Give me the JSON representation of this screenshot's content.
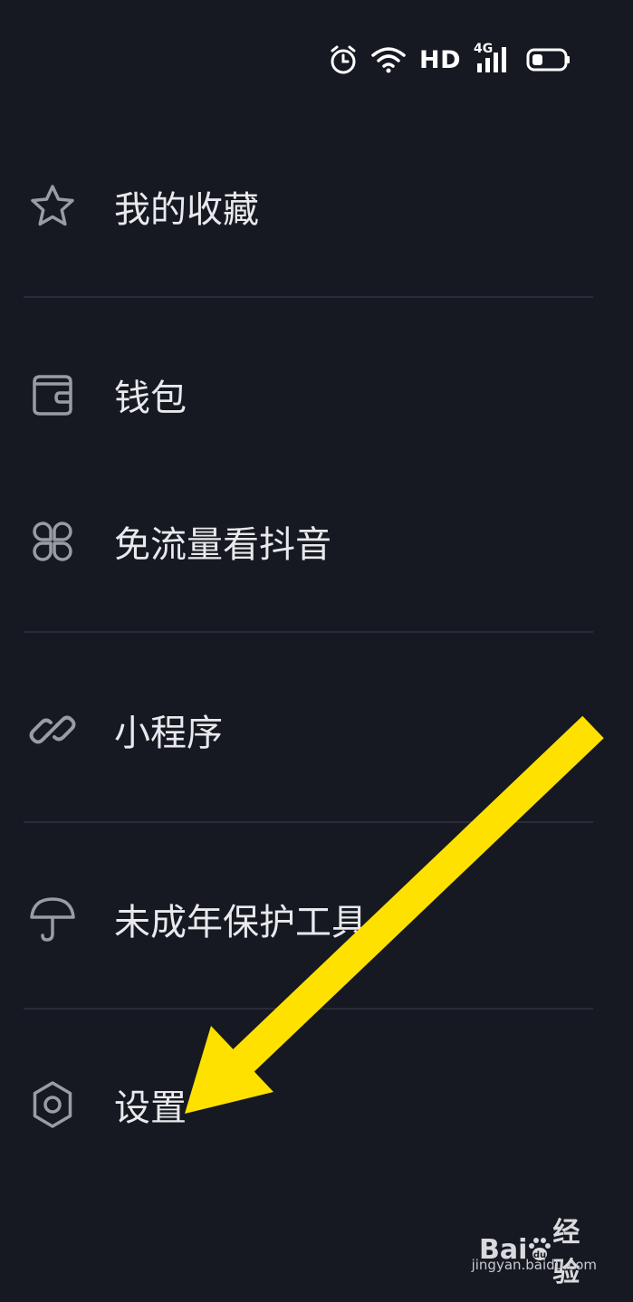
{
  "status_bar": {
    "hd_label": "HD",
    "network_label": "4G",
    "icons": [
      "alarm-icon",
      "wifi-icon",
      "signal-icon",
      "battery-icon"
    ]
  },
  "menu": {
    "favorites": {
      "label": "我的收藏",
      "icon": "star-icon"
    },
    "wallet": {
      "label": "钱包",
      "icon": "wallet-icon"
    },
    "free_data": {
      "label": "免流量看抖音",
      "icon": "clover-icon"
    },
    "mini_programs": {
      "label": "小程序",
      "icon": "link-icon"
    },
    "minor_protection": {
      "label": "未成年保护工具",
      "icon": "umbrella-icon"
    },
    "settings": {
      "label": "设置",
      "icon": "gear-icon"
    }
  },
  "annotation": {
    "arrow_color": "#FFE100"
  },
  "watermark": {
    "logo_text": "Bai",
    "logo_suffix": "经验",
    "url": "jingyan.baidu.com"
  },
  "colors": {
    "background": "#161922",
    "text": "#E8E9EC",
    "icon": "#9A9CA4",
    "divider": "#2A2D37"
  }
}
